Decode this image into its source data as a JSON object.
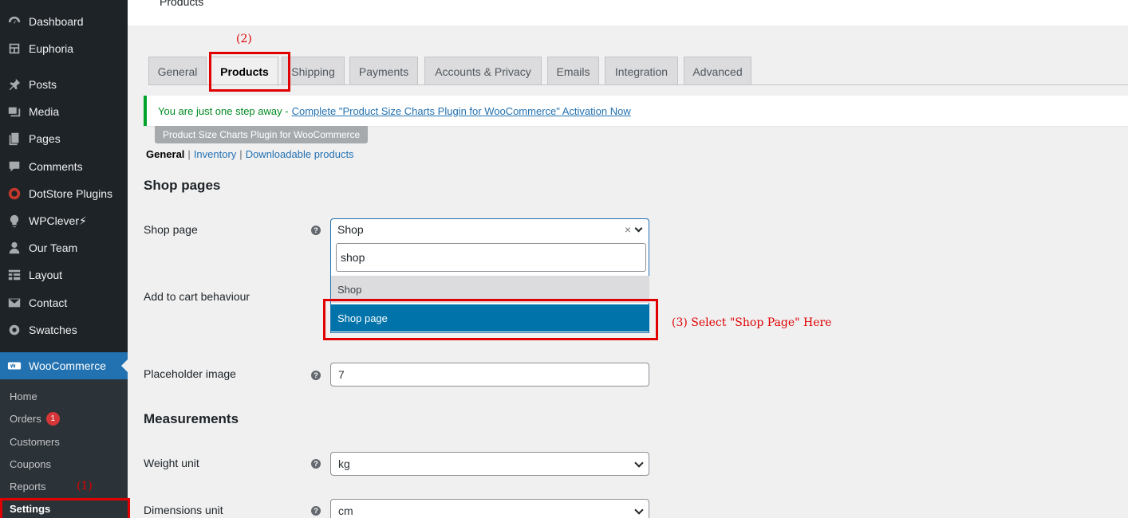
{
  "topbar": {
    "title": "Products"
  },
  "sidebar": {
    "items": [
      {
        "label": "Dashboard",
        "icon": "dashboard-icon"
      },
      {
        "label": "Euphoria",
        "icon": "layout-icon"
      },
      {
        "label": "Posts",
        "icon": "pin-icon"
      },
      {
        "label": "Media",
        "icon": "media-icon"
      },
      {
        "label": "Pages",
        "icon": "pages-icon"
      },
      {
        "label": "Comments",
        "icon": "comment-icon"
      },
      {
        "label": "DotStore Plugins",
        "icon": "dotstore-icon"
      },
      {
        "label": "WPClever⚡",
        "icon": "bulb-icon"
      },
      {
        "label": "Our Team",
        "icon": "team-icon"
      },
      {
        "label": "Layout",
        "icon": "grid-icon"
      },
      {
        "label": "Contact",
        "icon": "mail-icon"
      },
      {
        "label": "Swatches",
        "icon": "gear-icon"
      },
      {
        "label": "WooCommerce",
        "icon": "woo-icon"
      }
    ],
    "submenu": {
      "home": "Home",
      "orders": "Orders",
      "orders_badge": "1",
      "customers": "Customers",
      "coupons": "Coupons",
      "reports": "Reports",
      "settings": "Settings"
    }
  },
  "tabs": [
    "General",
    "Products",
    "Shipping",
    "Payments",
    "Accounts & Privacy",
    "Emails",
    "Integration",
    "Advanced"
  ],
  "notice": {
    "text": "You are just one step away -",
    "link": "Complete \"Product Size Charts Plugin for WooCommerce\" Activation Now"
  },
  "plugin_tag": "Product Size Charts Plugin for WooCommerce",
  "subsections": {
    "current": "General",
    "inventory": "Inventory",
    "downloadable": "Downloadable products",
    "sep": "|"
  },
  "shop_pages": {
    "heading": "Shop pages",
    "shop_page_label": "Shop page",
    "shop_page_value": "Shop",
    "clear": "×",
    "search_value": "shop",
    "options": [
      "Shop",
      "Shop page"
    ],
    "add_to_cart_label": "Add to cart behaviour",
    "placeholder_label": "Placeholder image",
    "placeholder_value": "7"
  },
  "measurements": {
    "heading": "Measurements",
    "weight_label": "Weight unit",
    "weight_value": "kg",
    "dimensions_label": "Dimensions unit",
    "dimensions_value": "cm"
  },
  "help_glyph": "?",
  "annotations": {
    "step1": "(1)",
    "step2": "(2)",
    "step3": "(3) Select \"Shop Page\" Here",
    "color": "#e00000"
  },
  "colors": {
    "accent": "#2271b1",
    "sidebar": "#1d2327",
    "notice": "#00a32a",
    "selected": "#0073aa"
  }
}
